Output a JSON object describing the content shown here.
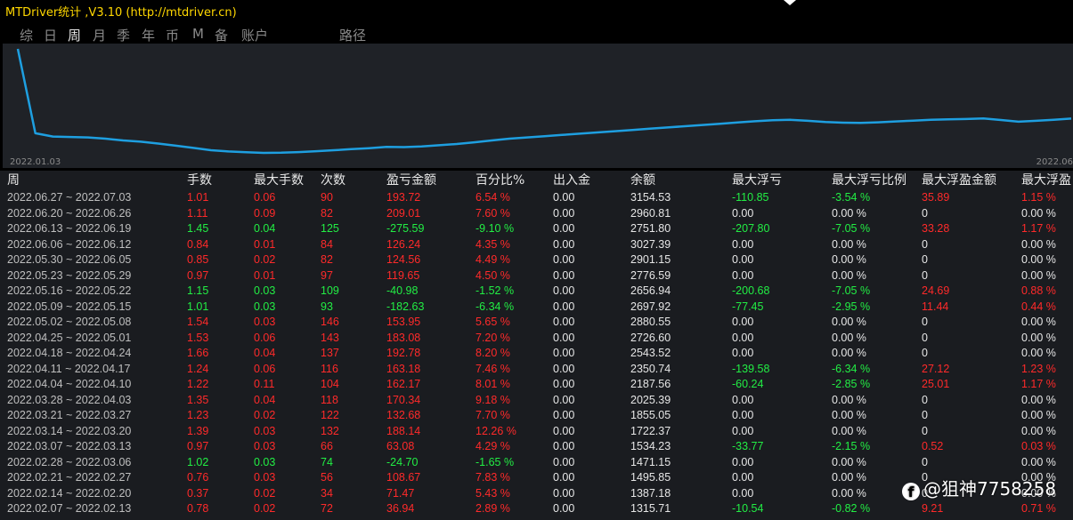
{
  "window": {
    "title": "MTDriver统计 ,V3.10 (http://mtdriver.cn)"
  },
  "tabs": [
    {
      "label": "综",
      "active": false
    },
    {
      "label": "日",
      "active": false
    },
    {
      "label": "周",
      "active": true
    },
    {
      "label": "月",
      "active": false
    },
    {
      "label": "季",
      "active": false
    },
    {
      "label": "年",
      "active": false
    },
    {
      "label": "币",
      "active": false
    },
    {
      "label": "M",
      "active": false
    },
    {
      "label": "备",
      "active": false
    },
    {
      "label": "账户",
      "active": false
    },
    {
      "label": "路径",
      "active": false
    }
  ],
  "chart_data": {
    "type": "line",
    "x_start_label": "2022.01.03",
    "x_end_label": "2022.06",
    "line_color": "#1e9fe0",
    "grid": false,
    "values": [
      3060,
      1020,
      940,
      930,
      920,
      890,
      845,
      815,
      770,
      720,
      665,
      610,
      580,
      560,
      545,
      550,
      565,
      585,
      610,
      635,
      660,
      690,
      685,
      700,
      730,
      760,
      800,
      845,
      890,
      920,
      950,
      980,
      1010,
      1040,
      1070,
      1100,
      1130,
      1160,
      1190,
      1220,
      1250,
      1280,
      1310,
      1335,
      1345,
      1320,
      1290,
      1275,
      1270,
      1285,
      1305,
      1325,
      1345,
      1355,
      1365,
      1380,
      1340,
      1300,
      1320,
      1345,
      1375
    ]
  },
  "table": {
    "headers": [
      "周",
      "手数",
      "最大手数",
      "次数",
      "盈亏金额",
      "百分比%",
      "出入金",
      "余额",
      "最大浮亏",
      "最大浮亏比例",
      "最大浮盈金额",
      "最大浮盈"
    ],
    "rows": [
      {
        "week": "2022.06.27 ~ 2022.07.03",
        "lots": "1.01",
        "max_lots": "0.06",
        "count": "90",
        "pnl": "193.72",
        "pct": "6.54 %",
        "io": "0.00",
        "balance": "3154.53",
        "max_dd": "-110.85",
        "max_dd_pct": "-3.54 %",
        "max_float": "35.89",
        "max_float_pct": "1.15 %",
        "c": "red",
        "dd": "green",
        "fl": "red"
      },
      {
        "week": "2022.06.20 ~ 2022.06.26",
        "lots": "1.11",
        "max_lots": "0.09",
        "count": "82",
        "pnl": "209.01",
        "pct": "7.60 %",
        "io": "0.00",
        "balance": "2960.81",
        "max_dd": "0.00",
        "max_dd_pct": "0.00 %",
        "max_float": "0",
        "max_float_pct": "0.00 %",
        "c": "red",
        "dd": "white",
        "fl": "white"
      },
      {
        "week": "2022.06.13 ~ 2022.06.19",
        "lots": "1.45",
        "max_lots": "0.04",
        "count": "125",
        "pnl": "-275.59",
        "pct": "-9.10 %",
        "io": "0.00",
        "balance": "2751.80",
        "max_dd": "-207.80",
        "max_dd_pct": "-7.05 %",
        "max_float": "33.28",
        "max_float_pct": "1.17 %",
        "c": "green",
        "dd": "green",
        "fl": "red"
      },
      {
        "week": "2022.06.06 ~ 2022.06.12",
        "lots": "0.84",
        "max_lots": "0.01",
        "count": "84",
        "pnl": "126.24",
        "pct": "4.35 %",
        "io": "0.00",
        "balance": "3027.39",
        "max_dd": "0.00",
        "max_dd_pct": "0.00 %",
        "max_float": "0",
        "max_float_pct": "0.00 %",
        "c": "red",
        "dd": "white",
        "fl": "white"
      },
      {
        "week": "2022.05.30 ~ 2022.06.05",
        "lots": "0.85",
        "max_lots": "0.02",
        "count": "82",
        "pnl": "124.56",
        "pct": "4.49 %",
        "io": "0.00",
        "balance": "2901.15",
        "max_dd": "0.00",
        "max_dd_pct": "0.00 %",
        "max_float": "0",
        "max_float_pct": "0.00 %",
        "c": "red",
        "dd": "white",
        "fl": "white"
      },
      {
        "week": "2022.05.23 ~ 2022.05.29",
        "lots": "0.97",
        "max_lots": "0.01",
        "count": "97",
        "pnl": "119.65",
        "pct": "4.50 %",
        "io": "0.00",
        "balance": "2776.59",
        "max_dd": "0.00",
        "max_dd_pct": "0.00 %",
        "max_float": "0",
        "max_float_pct": "0.00 %",
        "c": "red",
        "dd": "white",
        "fl": "white"
      },
      {
        "week": "2022.05.16 ~ 2022.05.22",
        "lots": "1.15",
        "max_lots": "0.03",
        "count": "109",
        "pnl": "-40.98",
        "pct": "-1.52 %",
        "io": "0.00",
        "balance": "2656.94",
        "max_dd": "-200.68",
        "max_dd_pct": "-7.05 %",
        "max_float": "24.69",
        "max_float_pct": "0.88 %",
        "c": "green",
        "dd": "green",
        "fl": "red"
      },
      {
        "week": "2022.05.09 ~ 2022.05.15",
        "lots": "1.01",
        "max_lots": "0.03",
        "count": "93",
        "pnl": "-182.63",
        "pct": "-6.34 %",
        "io": "0.00",
        "balance": "2697.92",
        "max_dd": "-77.45",
        "max_dd_pct": "-2.95 %",
        "max_float": "11.44",
        "max_float_pct": "0.44 %",
        "c": "green",
        "dd": "green",
        "fl": "red"
      },
      {
        "week": "2022.05.02 ~ 2022.05.08",
        "lots": "1.54",
        "max_lots": "0.03",
        "count": "146",
        "pnl": "153.95",
        "pct": "5.65 %",
        "io": "0.00",
        "balance": "2880.55",
        "max_dd": "0.00",
        "max_dd_pct": "0.00 %",
        "max_float": "0",
        "max_float_pct": "0.00 %",
        "c": "red",
        "dd": "white",
        "fl": "white"
      },
      {
        "week": "2022.04.25 ~ 2022.05.01",
        "lots": "1.53",
        "max_lots": "0.06",
        "count": "143",
        "pnl": "183.08",
        "pct": "7.20 %",
        "io": "0.00",
        "balance": "2726.60",
        "max_dd": "0.00",
        "max_dd_pct": "0.00 %",
        "max_float": "0",
        "max_float_pct": "0.00 %",
        "c": "red",
        "dd": "white",
        "fl": "white"
      },
      {
        "week": "2022.04.18 ~ 2022.04.24",
        "lots": "1.66",
        "max_lots": "0.04",
        "count": "137",
        "pnl": "192.78",
        "pct": "8.20 %",
        "io": "0.00",
        "balance": "2543.52",
        "max_dd": "0.00",
        "max_dd_pct": "0.00 %",
        "max_float": "0",
        "max_float_pct": "0.00 %",
        "c": "red",
        "dd": "white",
        "fl": "white"
      },
      {
        "week": "2022.04.11 ~ 2022.04.17",
        "lots": "1.24",
        "max_lots": "0.06",
        "count": "116",
        "pnl": "163.18",
        "pct": "7.46 %",
        "io": "0.00",
        "balance": "2350.74",
        "max_dd": "-139.58",
        "max_dd_pct": "-6.34 %",
        "max_float": "27.12",
        "max_float_pct": "1.23 %",
        "c": "red",
        "dd": "green",
        "fl": "red"
      },
      {
        "week": "2022.04.04 ~ 2022.04.10",
        "lots": "1.22",
        "max_lots": "0.11",
        "count": "104",
        "pnl": "162.17",
        "pct": "8.01 %",
        "io": "0.00",
        "balance": "2187.56",
        "max_dd": "-60.24",
        "max_dd_pct": "-2.85 %",
        "max_float": "25.01",
        "max_float_pct": "1.17 %",
        "c": "red",
        "dd": "green",
        "fl": "red"
      },
      {
        "week": "2022.03.28 ~ 2022.04.03",
        "lots": "1.35",
        "max_lots": "0.04",
        "count": "118",
        "pnl": "170.34",
        "pct": "9.18 %",
        "io": "0.00",
        "balance": "2025.39",
        "max_dd": "0.00",
        "max_dd_pct": "0.00 %",
        "max_float": "0",
        "max_float_pct": "0.00 %",
        "c": "red",
        "dd": "white",
        "fl": "white"
      },
      {
        "week": "2022.03.21 ~ 2022.03.27",
        "lots": "1.23",
        "max_lots": "0.02",
        "count": "122",
        "pnl": "132.68",
        "pct": "7.70 %",
        "io": "0.00",
        "balance": "1855.05",
        "max_dd": "0.00",
        "max_dd_pct": "0.00 %",
        "max_float": "0",
        "max_float_pct": "0.00 %",
        "c": "red",
        "dd": "white",
        "fl": "white"
      },
      {
        "week": "2022.03.14 ~ 2022.03.20",
        "lots": "1.39",
        "max_lots": "0.03",
        "count": "132",
        "pnl": "188.14",
        "pct": "12.26 %",
        "io": "0.00",
        "balance": "1722.37",
        "max_dd": "0.00",
        "max_dd_pct": "0.00 %",
        "max_float": "0",
        "max_float_pct": "0.00 %",
        "c": "red",
        "dd": "white",
        "fl": "white"
      },
      {
        "week": "2022.03.07 ~ 2022.03.13",
        "lots": "0.97",
        "max_lots": "0.03",
        "count": "66",
        "pnl": "63.08",
        "pct": "4.29 %",
        "io": "0.00",
        "balance": "1534.23",
        "max_dd": "-33.77",
        "max_dd_pct": "-2.15 %",
        "max_float": "0.52",
        "max_float_pct": "0.03 %",
        "c": "red",
        "dd": "green",
        "fl": "red"
      },
      {
        "week": "2022.02.28 ~ 2022.03.06",
        "lots": "1.02",
        "max_lots": "0.03",
        "count": "74",
        "pnl": "-24.70",
        "pct": "-1.65 %",
        "io": "0.00",
        "balance": "1471.15",
        "max_dd": "0.00",
        "max_dd_pct": "0.00 %",
        "max_float": "0",
        "max_float_pct": "0.00 %",
        "c": "green",
        "dd": "white",
        "fl": "white"
      },
      {
        "week": "2022.02.21 ~ 2022.02.27",
        "lots": "0.76",
        "max_lots": "0.03",
        "count": "56",
        "pnl": "108.67",
        "pct": "7.83 %",
        "io": "0.00",
        "balance": "1495.85",
        "max_dd": "0.00",
        "max_dd_pct": "0.00 %",
        "max_float": "0",
        "max_float_pct": "0.00 %",
        "c": "red",
        "dd": "white",
        "fl": "white"
      },
      {
        "week": "2022.02.14 ~ 2022.02.20",
        "lots": "0.37",
        "max_lots": "0.02",
        "count": "34",
        "pnl": "71.47",
        "pct": "5.43 %",
        "io": "0.00",
        "balance": "1387.18",
        "max_dd": "0.00",
        "max_dd_pct": "0.00 %",
        "max_float": "0",
        "max_float_pct": "0.00 %",
        "c": "red",
        "dd": "white",
        "fl": "white"
      },
      {
        "week": "2022.02.07 ~ 2022.02.13",
        "lots": "0.78",
        "max_lots": "0.02",
        "count": "72",
        "pnl": "36.94",
        "pct": "2.89 %",
        "io": "0.00",
        "balance": "1315.71",
        "max_dd": "-10.54",
        "max_dd_pct": "-0.82 %",
        "max_float": "9.21",
        "max_float_pct": "0.71 %",
        "c": "red",
        "dd": "green",
        "fl": "red"
      }
    ]
  },
  "watermark": {
    "icon": "facebook-icon",
    "text": "@狙神7758258"
  },
  "colors": {
    "profit": "#ff2a2a",
    "loss": "#22ee44",
    "neutral": "#e6e6e6",
    "title": "#ffd700",
    "line": "#1e9fe0"
  }
}
